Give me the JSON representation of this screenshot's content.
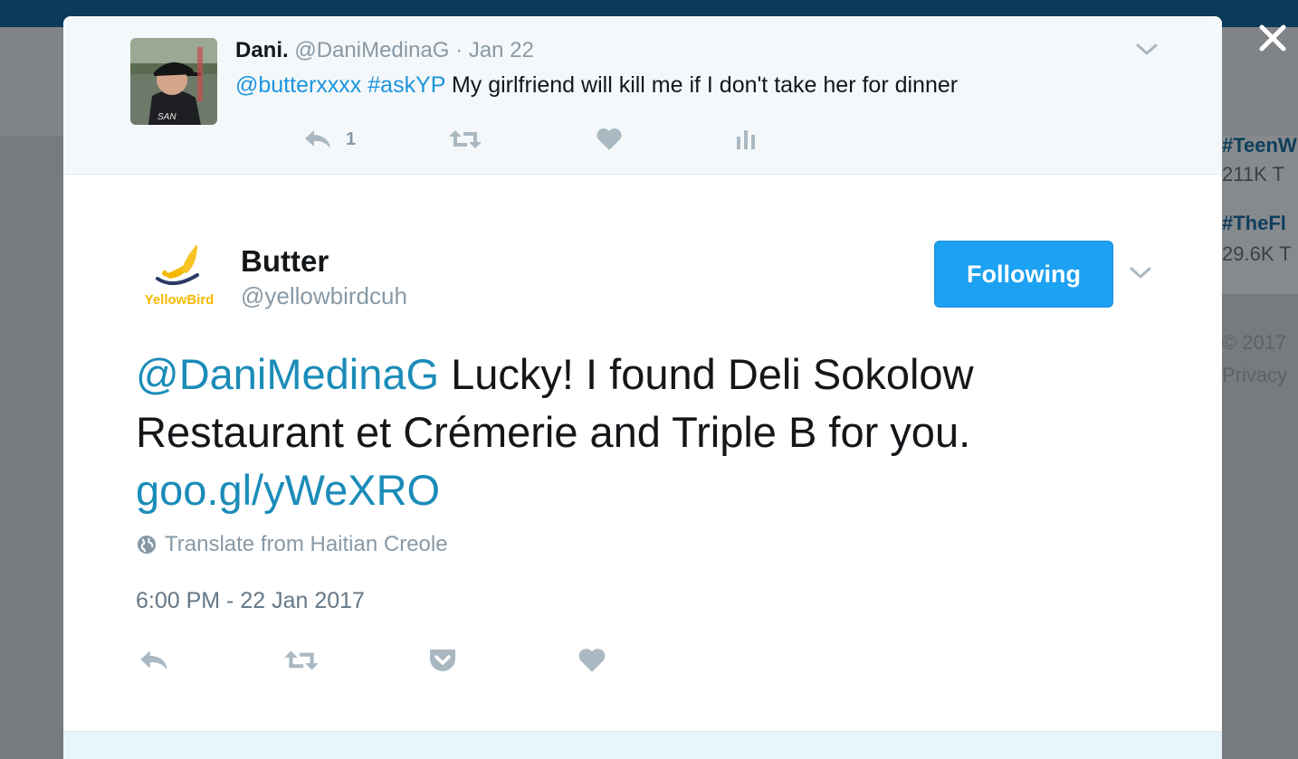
{
  "background": {
    "trends": [
      {
        "tag": "#TeenW",
        "count": "211K T"
      },
      {
        "tag": "#TheFl",
        "count": "29.6K T"
      }
    ],
    "footer": {
      "copyright": "© 2017",
      "privacy": "Privacy"
    }
  },
  "parent_tweet": {
    "name": "Dani.",
    "handle": "@DaniMedinaG",
    "separator": "·",
    "date": "Jan 22",
    "mention": "@butterxxxx",
    "hashtag": "#askYP",
    "text": "My girlfriend will kill me if I don't take her for dinner",
    "reply_count": "1"
  },
  "main_tweet": {
    "name": "Butter",
    "handle": "@yellowbirdcuh",
    "logo_text": "YellowBird",
    "follow_label": "Following",
    "mention": "@DaniMedinaG",
    "text": "Lucky! I found Deli Sokolow Restaurant et Crémerie and Triple B for you.",
    "link": "goo.gl/yWeXRO",
    "translate": "Translate from Haitian Creole",
    "timestamp": "6:00 PM - 22 Jan 2017"
  },
  "colors": {
    "accent": "#1da1f2",
    "link": "#1b95e0",
    "icon_gray": "#aab8c2",
    "brand_yellow": "#f5b800",
    "logo_navy": "#2b3a67"
  }
}
